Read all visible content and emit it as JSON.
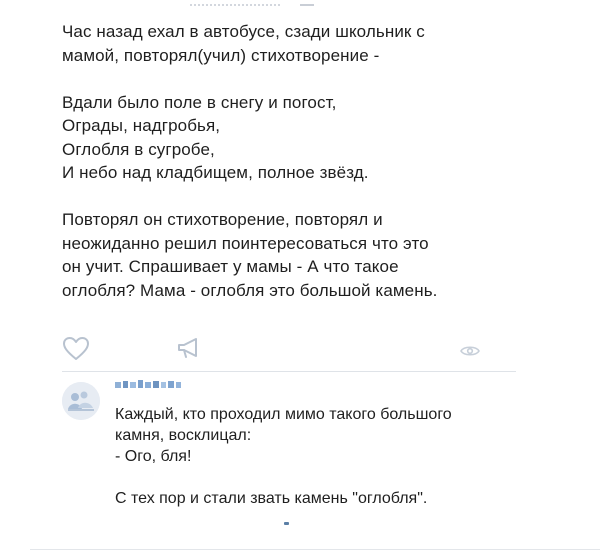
{
  "post": {
    "paragraphs": [
      [
        "Час назад ехал в автобусе, сзади школьник с",
        "мамой, повторял(учил) стихотворение -"
      ],
      [
        "Вдали было поле в снегу и погост,",
        "Ограды, надгробья,",
        "Оглобля в сугробе,",
        "И небо над кладбищем, полное звёзд."
      ],
      [
        "Повторял он стихотворение, повторял и",
        "неожиданно решил поинтересоваться что это",
        "он учит. Спрашивает у мамы - А что такое",
        "оглобля? Мама - оглобля это большой камень."
      ]
    ],
    "actions": {
      "like_icon": "heart-icon",
      "share_icon": "megaphone-icon",
      "views_icon": "eye-icon"
    }
  },
  "comment": {
    "paragraphs": [
      [
        "Каждый, кто проходил мимо такого большого",
        "камня, восклицал:",
        "- Ого, бля!"
      ],
      [
        "С тех пор и стали звать камень \"оглобля\"."
      ]
    ]
  },
  "colors": {
    "icon": "#b8c2cf",
    "text": "#1f1f1f",
    "divider": "#dfe3e8",
    "accent": "#5b7fa6"
  }
}
